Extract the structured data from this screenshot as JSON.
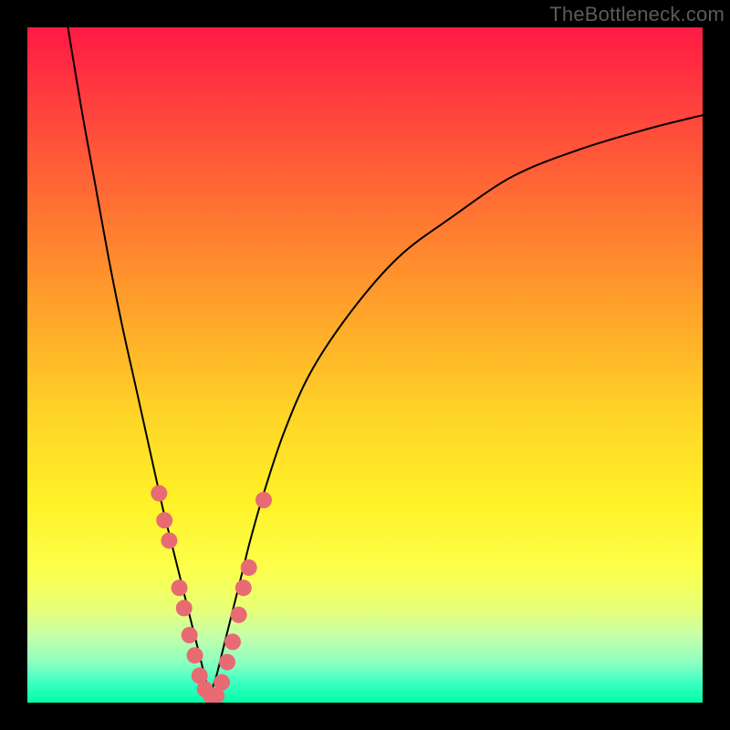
{
  "watermark": "TheBottleneck.com",
  "colors": {
    "frame": "#000000",
    "curve": "#000000",
    "marker": "#e86a72",
    "gradient_top": "#ff1a44",
    "gradient_bottom": "#00ffa8"
  },
  "chart_data": {
    "type": "line",
    "title": "",
    "xlabel": "",
    "ylabel": "",
    "xlim": [
      0,
      100
    ],
    "ylim": [
      0,
      100
    ],
    "grid": false,
    "legend": false,
    "note": "Bottleneck curve: two branches descending into a V at roughly x≈27, y≈0; markers cluster near the valley along both branches.",
    "series": [
      {
        "name": "left-branch",
        "x": [
          6,
          8,
          10,
          12,
          14,
          16,
          18,
          20,
          21,
          22,
          23,
          24,
          25,
          26,
          27
        ],
        "y": [
          100,
          88,
          77,
          66,
          56,
          47,
          38,
          29,
          25,
          21,
          17,
          13,
          9,
          5,
          1
        ]
      },
      {
        "name": "right-branch",
        "x": [
          27,
          28,
          29,
          30,
          31,
          32,
          33,
          35,
          38,
          42,
          48,
          55,
          63,
          72,
          82,
          92,
          100
        ],
        "y": [
          1,
          4,
          8,
          12,
          16,
          20,
          24,
          31,
          40,
          49,
          58,
          66,
          72,
          78,
          82,
          85,
          87
        ]
      }
    ],
    "markers": [
      {
        "x": 19.5,
        "y": 31
      },
      {
        "x": 20.3,
        "y": 27
      },
      {
        "x": 21.0,
        "y": 24
      },
      {
        "x": 22.5,
        "y": 17
      },
      {
        "x": 23.2,
        "y": 14
      },
      {
        "x": 24.0,
        "y": 10
      },
      {
        "x": 24.8,
        "y": 7
      },
      {
        "x": 25.5,
        "y": 4
      },
      {
        "x": 26.3,
        "y": 2
      },
      {
        "x": 27.2,
        "y": 1
      },
      {
        "x": 28.0,
        "y": 1
      },
      {
        "x": 28.8,
        "y": 3
      },
      {
        "x": 29.6,
        "y": 6
      },
      {
        "x": 30.4,
        "y": 9
      },
      {
        "x": 31.3,
        "y": 13
      },
      {
        "x": 32.0,
        "y": 17
      },
      {
        "x": 32.8,
        "y": 20
      },
      {
        "x": 35.0,
        "y": 30
      }
    ]
  }
}
